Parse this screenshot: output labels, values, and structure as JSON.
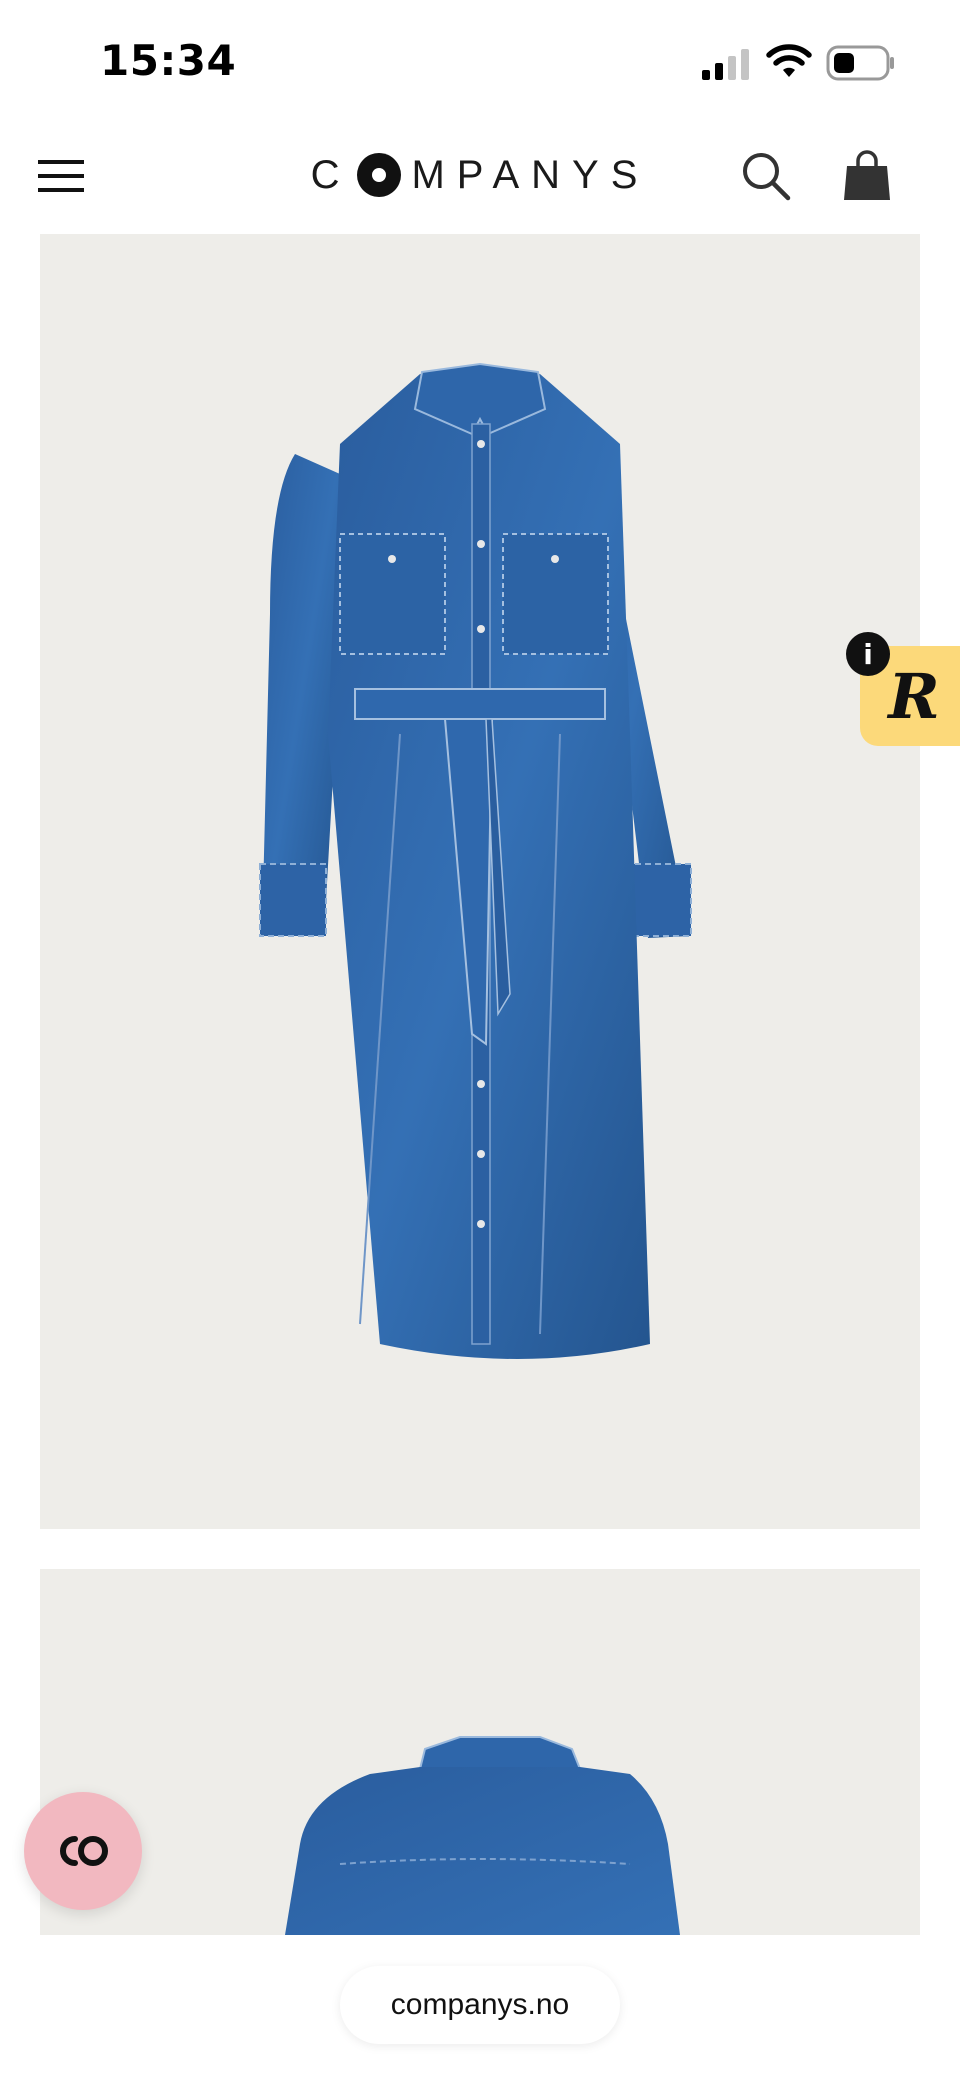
{
  "status_bar": {
    "time": "15:34",
    "icons": [
      "cellular-signal-icon",
      "wifi-icon",
      "battery-icon"
    ]
  },
  "header": {
    "brand": "COMPANYS",
    "brand_before_o": "C",
    "brand_after_o": "MPANYS",
    "icons": [
      "hamburger-menu-icon",
      "search-icon",
      "shopping-bag-icon"
    ]
  },
  "product": {
    "images": [
      {
        "description_icon": "denim-shirt-dress-front"
      },
      {
        "description_icon": "denim-shirt-dress-back"
      }
    ],
    "background": "#eeede9",
    "denim_color": "#2f64a8"
  },
  "widgets": {
    "r_badge_letter": "R",
    "info_glyph": "i",
    "badge_color": "#fcd97a",
    "chat_button_color": "#f2b8c0"
  },
  "browser": {
    "url": "companys.no"
  }
}
